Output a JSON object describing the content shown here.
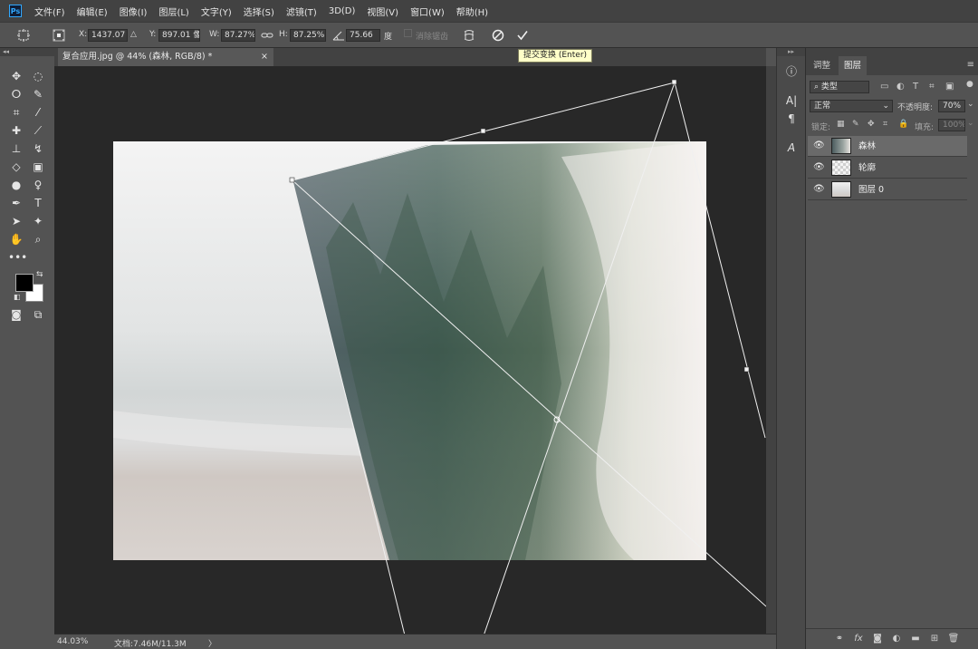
{
  "app": {
    "logo": "Ps"
  },
  "menu": [
    "文件(F)",
    "编辑(E)",
    "图像(I)",
    "图层(L)",
    "文字(Y)",
    "选择(S)",
    "滤镜(T)",
    "3D(D)",
    "视图(V)",
    "窗口(W)",
    "帮助(H)"
  ],
  "options": {
    "x_label": "X:",
    "x_value": "1437.07 像",
    "y_label": "Y:",
    "y_value": "897.01 像",
    "w_label": "W:",
    "w_value": "87.27%",
    "h_label": "H:",
    "h_value": "87.25%",
    "angle_value": "75.66",
    "angle_unit": "度",
    "interp_label": "消除锯齿",
    "tooltip": "提交变换 (Enter)"
  },
  "document_tab": {
    "title": "复合应用.jpg @ 44% (森林, RGB/8) *",
    "close": "×"
  },
  "status": {
    "zoom": "44.03%",
    "doc_info": "文档:7.46M/11.3M",
    "arrow": "〉"
  },
  "panels": {
    "tabs": [
      "调整",
      "图层"
    ],
    "active_tab": "图层",
    "filter_placeholder": "类型",
    "blend_mode": "正常",
    "opacity_label": "不透明度:",
    "opacity_value": "70%",
    "lock_label": "锁定:",
    "fill_label": "填充:",
    "fill_value": "100%",
    "layers": [
      {
        "name": "森林",
        "selected": true
      },
      {
        "name": "轮廓",
        "selected": false
      },
      {
        "name": "图层 0",
        "selected": false
      }
    ]
  },
  "colors": {
    "accent": "#31a8ff",
    "tooltip_bg": "#ffffc8",
    "selected_layer": "#6a6a6a"
  }
}
